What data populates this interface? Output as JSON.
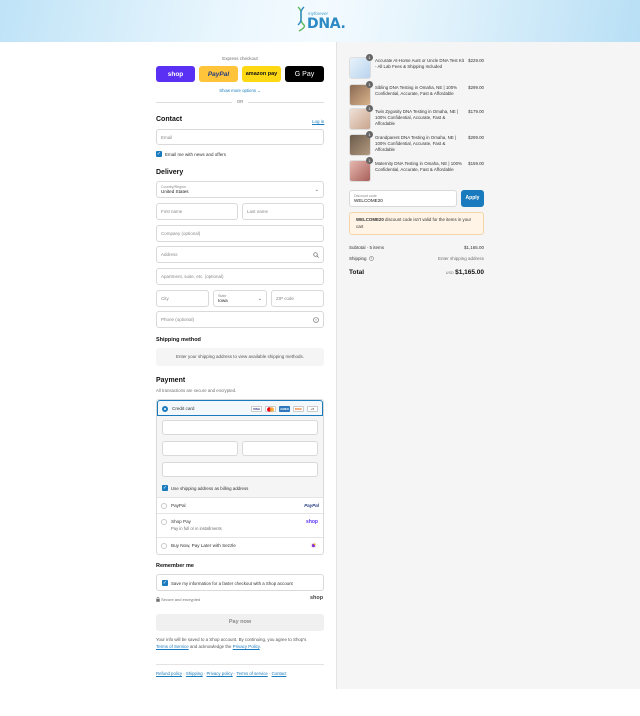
{
  "brand": {
    "small": "myforever",
    "big": "DNA."
  },
  "express": {
    "title": "Express checkout",
    "shop": "shop",
    "paypal": "PayPal",
    "amazon": "amazon pay",
    "gpay": "G Pay",
    "show_more": "Show more options ⌄",
    "or": "OR"
  },
  "contact": {
    "heading": "Contact",
    "login": "Log in",
    "email_placeholder": "Email",
    "news_label": "Email me with news and offers"
  },
  "delivery": {
    "heading": "Delivery",
    "country_label": "Country/Region",
    "country_value": "United States",
    "first_name": "First name",
    "last_name": "Last name",
    "company": "Company (optional)",
    "address": "Address",
    "apartment": "Apartment, suite, etc. (optional)",
    "city": "City",
    "state_label": "State",
    "state_value": "Iowa",
    "zip": "ZIP code",
    "phone": "Phone (optional)"
  },
  "shipping_method": {
    "heading": "Shipping method",
    "notice": "Enter your shipping address to view available shipping methods."
  },
  "payment": {
    "heading": "Payment",
    "subtitle": "All transactions are secure and encrypted.",
    "credit_card": "Credit card",
    "card_more": "+5",
    "billing_label": "Use shipping address as billing address",
    "paypal": "PayPal",
    "shop_pay": "Shop Pay",
    "shop_pay_sub": "Pay in full or in installments",
    "sezzle": "Buy Now, Pay Later with Sezzle",
    "shop_logo": "shop"
  },
  "remember": {
    "heading": "Remember me",
    "save_label": "Save my information for a faster checkout with a Shop account",
    "secure": "Secure and encrypted",
    "shop_logo": "shop"
  },
  "pay_now": "Pay now",
  "legal": {
    "text1": "Your info will be saved to a Shop account. By continuing, you agree to Shop's",
    "terms": "Terms of Service",
    "text2": "and acknowledge the",
    "privacy": "Privacy Policy",
    "end": "."
  },
  "footer": [
    "Refund policy",
    "Shipping",
    "Privacy policy",
    "Terms of service",
    "Contact"
  ],
  "cart": {
    "items": [
      {
        "name": "Accurate At-Home Aunt or Uncle DNA Test Kit - All Lab Fees & Shipping Included",
        "price": "$229.00",
        "qty": "1"
      },
      {
        "name": "Sibling DNA Testing in Omaha, NE | 100% Confidential, Accurate, Fast & Affordable",
        "price": "$299.00",
        "qty": "1"
      },
      {
        "name": "Twin Zygosity DNA Testing in Omaha, NE | 100% Confidential, Accurate, Fast & Affordable",
        "price": "$179.00",
        "qty": "1"
      },
      {
        "name": "Grandparent DNA Testing in Omaha, NE | 100% Confidential, Accurate, Fast & Affordable",
        "price": "$299.00",
        "qty": "1"
      },
      {
        "name": "Maternity DNA Testing in Omaha, NE | 100% Confidential, Accurate, Fast & Affordable",
        "price": "$159.00",
        "qty": "1"
      }
    ],
    "discount_label": "Discount code",
    "discount_value": "WELCOME20",
    "apply": "Apply",
    "alert_code": "WELCOME20",
    "alert_text": " discount code isn't valid for the items in your cart",
    "subtotal_label": "Subtotal · 5 items",
    "subtotal_value": "$1,165.00",
    "shipping_label": "Shipping",
    "shipping_value": "Enter shipping address",
    "total_label": "Total",
    "currency": "USD",
    "total_value": "$1,165.00"
  },
  "colors": {
    "accent": "#197bbd",
    "shop": "#5a31f4",
    "paypal": "#ffc439",
    "amazon": "#ffd814"
  }
}
